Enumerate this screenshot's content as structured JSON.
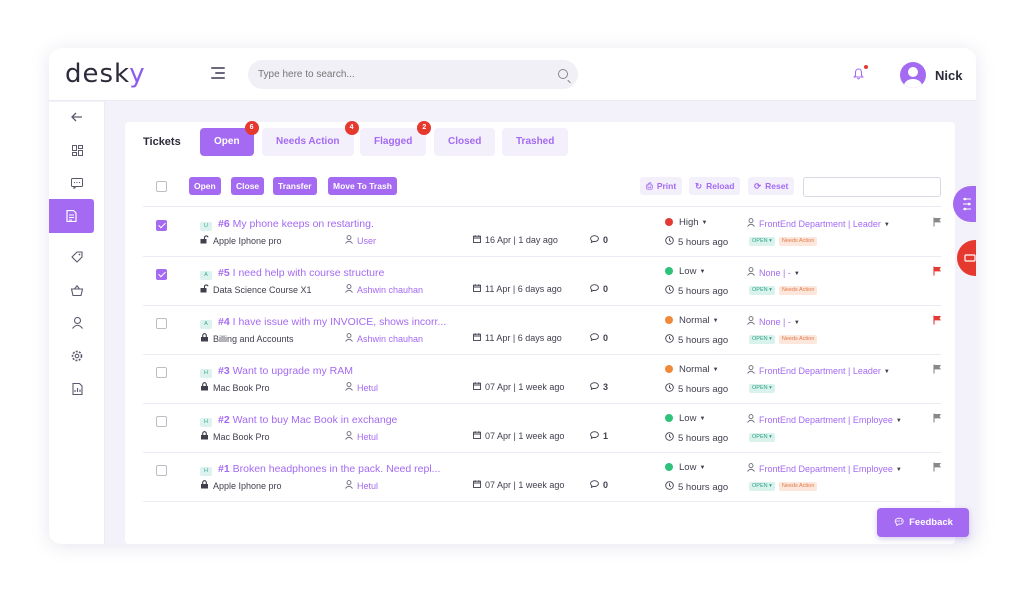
{
  "app": {
    "logo": "desky",
    "username": "Nick"
  },
  "search": {
    "placeholder": "Type here to search..."
  },
  "colors": {
    "accent": "#a46af2",
    "high": "#e53935",
    "low": "#2fc27a",
    "normal": "#f0893a"
  },
  "sidebar": {
    "items": [
      "back-arrow-icon",
      "dashboard-icon",
      "chat-icon",
      "tickets-icon",
      "tag-icon",
      "basket-icon",
      "user-icon",
      "settings-icon",
      "report-icon"
    ],
    "active_index": 3
  },
  "tabs": {
    "label": "Tickets",
    "items": [
      {
        "label": "Open",
        "count": "6",
        "active": true
      },
      {
        "label": "Needs Action",
        "count": "4",
        "active": false
      },
      {
        "label": "Flagged",
        "count": "2",
        "active": false
      },
      {
        "label": "Closed",
        "count": "",
        "active": false
      },
      {
        "label": "Trashed",
        "count": "",
        "active": false
      }
    ]
  },
  "actions": {
    "open": "Open",
    "close": "Close",
    "transfer": "Transfer",
    "move_to_trash": "Move To Trash",
    "print": "Print",
    "reload": "Reload",
    "reset": "Reset"
  },
  "tickets": [
    {
      "checked": true,
      "tag": "U",
      "num": "#6",
      "title": "My phone keeps on restarting.",
      "product": "Apple Iphone pro",
      "lock": "open",
      "user": "User",
      "date": "16 Apr | 1 day ago",
      "comments": "0",
      "priority": "High",
      "priority_color": "#e53935",
      "time": "5 hours ago",
      "assignee": "FrontEnd Department | Leader",
      "status": "OPEN",
      "needs_action": "Needs Action",
      "flag_color": "#888888"
    },
    {
      "checked": true,
      "tag": "A",
      "num": "#5",
      "title": "I need help with course structure",
      "product": "Data Science Course X1",
      "lock": "open",
      "user": "Ashwin chauhan",
      "date": "11 Apr | 6 days ago",
      "comments": "0",
      "priority": "Low",
      "priority_color": "#2fc27a",
      "time": "5 hours ago",
      "assignee": "None | -",
      "status": "OPEN",
      "needs_action": "Needs Action",
      "flag_color": "#e53935"
    },
    {
      "checked": false,
      "tag": "A",
      "num": "#4",
      "title": "I have issue with my INVOICE, shows incorr...",
      "product": "Billing and Accounts",
      "lock": "closed",
      "user": "Ashwin chauhan",
      "date": "11 Apr | 6 days ago",
      "comments": "0",
      "priority": "Normal",
      "priority_color": "#f0893a",
      "time": "5 hours ago",
      "assignee": "None | -",
      "status": "OPEN",
      "needs_action": "Needs Action",
      "flag_color": "#e53935"
    },
    {
      "checked": false,
      "tag": "H",
      "num": "#3",
      "title": "Want to upgrade my RAM",
      "product": "Mac Book Pro",
      "lock": "closed",
      "user": "Hetul",
      "date": "07 Apr | 1 week ago",
      "comments": "3",
      "priority": "Normal",
      "priority_color": "#f0893a",
      "time": "5 hours ago",
      "assignee": "FrontEnd Department | Leader",
      "status": "OPEN",
      "needs_action": "",
      "flag_color": "#888888"
    },
    {
      "checked": false,
      "tag": "H",
      "num": "#2",
      "title": "Want to buy Mac Book in exchange",
      "product": "Mac Book Pro",
      "lock": "closed",
      "user": "Hetul",
      "date": "07 Apr | 1 week ago",
      "comments": "1",
      "priority": "Low",
      "priority_color": "#2fc27a",
      "time": "5 hours ago",
      "assignee": "FrontEnd Department | Employee",
      "status": "OPEN",
      "needs_action": "",
      "flag_color": "#888888"
    },
    {
      "checked": false,
      "tag": "H",
      "num": "#1",
      "title": "Broken headphones in the pack. Need repl...",
      "product": "Apple Iphone pro",
      "lock": "closed",
      "user": "Hetul",
      "date": "07 Apr | 1 week ago",
      "comments": "0",
      "priority": "Low",
      "priority_color": "#2fc27a",
      "time": "5 hours ago",
      "assignee": "FrontEnd Department | Employee",
      "status": "OPEN",
      "needs_action": "Needs Action",
      "flag_color": "#888888"
    }
  ],
  "feedback": {
    "label": "Feedback"
  }
}
